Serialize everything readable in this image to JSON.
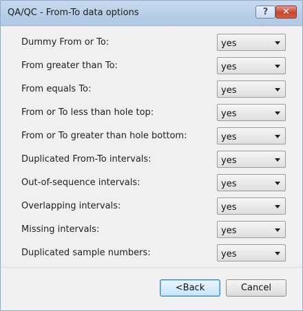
{
  "window": {
    "title": "QA/QC - From-To data options",
    "help_glyph": "?",
    "close_glyph": "✕"
  },
  "options": [
    {
      "label": "Dummy From or To:",
      "value": "yes"
    },
    {
      "label": "From greater than To:",
      "value": "yes"
    },
    {
      "label": "From equals To:",
      "value": "yes"
    },
    {
      "label": "From or To less than hole top:",
      "value": "yes"
    },
    {
      "label": "From or To greater than hole bottom:",
      "value": "yes"
    },
    {
      "label": "Duplicated From-To intervals:",
      "value": "yes"
    },
    {
      "label": "Out-of-sequence intervals:",
      "value": "yes"
    },
    {
      "label": "Overlapping intervals:",
      "value": "yes"
    },
    {
      "label": "Missing intervals:",
      "value": "yes"
    },
    {
      "label": "Duplicated sample numbers:",
      "value": "yes"
    }
  ],
  "buttons": {
    "back_label": "<Back",
    "cancel_label": "Cancel"
  }
}
